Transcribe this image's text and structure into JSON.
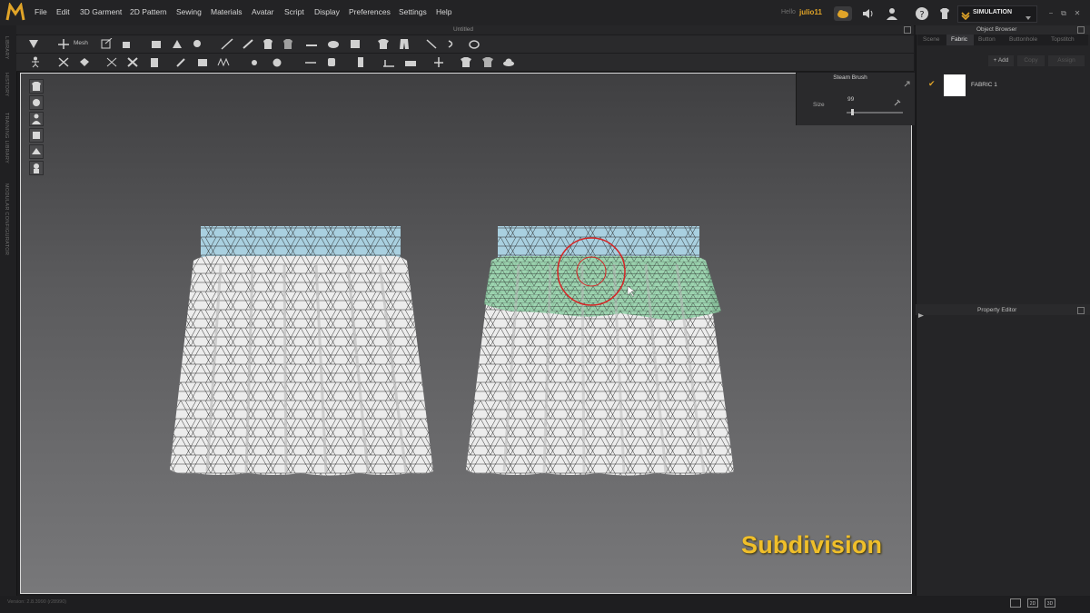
{
  "app": {
    "logo_letter": "M",
    "menu": [
      "File",
      "Edit",
      "3D Garment",
      "2D Pattern",
      "Sewing",
      "Materials",
      "Avatar",
      "Script",
      "Display",
      "Preferences",
      "Settings",
      "Help"
    ],
    "user_greeting": "Hello",
    "user_name": "julio11",
    "mode_label": "SIMULATION",
    "window_controls": [
      "−",
      "⧉",
      "✕"
    ]
  },
  "left_strip": {
    "tabs": [
      "LIBRARY",
      "HISTORY",
      "TRAINING LIBRARY",
      "MODULAR CONFIGURATOR"
    ]
  },
  "document": {
    "title": "Untitled"
  },
  "toolbar": {
    "mesh_label": "Mesh"
  },
  "steam_brush": {
    "title": "Steam Brush",
    "size_label": "Size",
    "size_value": "99",
    "size_fraction": 0.1
  },
  "overlay": {
    "caption": "Subdivision"
  },
  "status": {
    "version": "Version: 2.8.3990 (r28990)"
  },
  "object_browser": {
    "title": "Object Browser",
    "tabs": [
      "Scene",
      "Fabric",
      "Button",
      "Buttonhole",
      "Topstitch"
    ],
    "active_tab": "Fabric",
    "buttons": {
      "add": "+ Add",
      "copy": "Copy",
      "assign": "Assign"
    },
    "fabric_item": "FABRIC 1"
  },
  "property_editor": {
    "title": "Property Editor"
  },
  "view_modes": [
    "",
    "2D",
    "3D"
  ],
  "colors": {
    "accent": "#e0a428",
    "caption": "#f0bf2a",
    "waistband": "#a9d0e0",
    "steamed": "#8fd0a6",
    "brush_ring": "#d42525"
  }
}
